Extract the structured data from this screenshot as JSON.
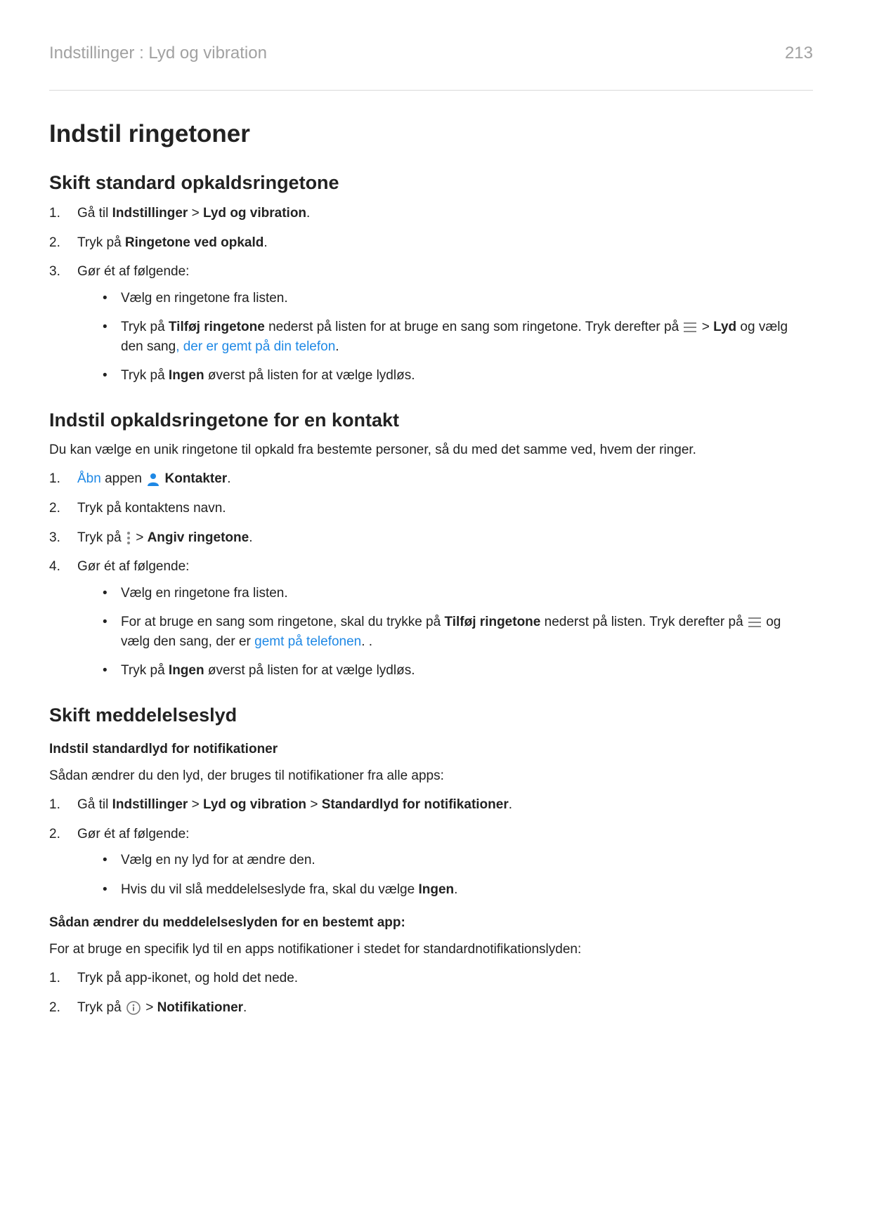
{
  "header": {
    "breadcrumb": "Indstillinger : Lyd og vibration",
    "page_number": "213"
  },
  "h1": "Indstil ringetoner",
  "sec1": {
    "h2": "Skift standard opkaldsringetone",
    "li1_a": "Gå til ",
    "li1_link": "Indstillinger",
    "li1_b": " > ",
    "li1_bold": "Lyd og vibration",
    "li1_c": ".",
    "li2_a": "Tryk på ",
    "li2_bold": "Ringetone ved opkald",
    "li2_b": ".",
    "li3": "Gør ét af følgende:",
    "li3_b1": "Vælg en ringetone fra listen.",
    "li3_b2_a": "Tryk på ",
    "li3_b2_bold1": "Tilføj ringetone",
    "li3_b2_b": " nederst på listen for at bruge en sang som ringetone. Tryk derefter på ",
    "li3_b2_c": " > ",
    "li3_b2_bold2": "Lyd",
    "li3_b2_d": " og vælg den sang",
    "li3_b2_link": ", der er gemt på din telefon",
    "li3_b2_e": ".",
    "li3_b3_a": "Tryk på ",
    "li3_b3_bold": "Ingen",
    "li3_b3_b": " øverst på listen for at vælge lydløs."
  },
  "sec2": {
    "h2": "Indstil opkaldsringetone for en kontakt",
    "intro": "Du kan vælge en unik ringetone til opkald fra bestemte personer, så du med det samme ved, hvem der ringer.",
    "li1_link": "Åbn",
    "li1_a": " appen ",
    "li1_bold": "Kontakter",
    "li1_b": ".",
    "li2": "Tryk på kontaktens navn.",
    "li3_a": "Tryk på ",
    "li3_b": " > ",
    "li3_bold": "Angiv ringetone",
    "li3_c": ".",
    "li4": "Gør ét af følgende:",
    "li4_b1": "Vælg en ringetone fra listen.",
    "li4_b2_a": "For at bruge en sang som ringetone, skal du trykke på ",
    "li4_b2_bold": "Tilføj ringetone",
    "li4_b2_b": " nederst på listen. Tryk derefter på ",
    "li4_b2_c": " og vælg den sang, der er ",
    "li4_b2_link": "gemt på telefonen",
    "li4_b2_d": ". .",
    "li4_b3_a": "Tryk på ",
    "li4_b3_bold": "Ingen",
    "li4_b3_b": " øverst på listen for at vælge lydløs."
  },
  "sec3": {
    "h2": "Skift meddelelseslyd",
    "h3a": "Indstil standardlyd for notifikationer",
    "p1": "Sådan ændrer du den lyd, der bruges til notifikationer fra alle apps:",
    "li1_a": "Gå til ",
    "li1_link": "Indstillinger",
    "li1_b": " > ",
    "li1_bold1": "Lyd og vibration",
    "li1_c": " > ",
    "li1_bold2": "Standardlyd for notifikationer",
    "li1_d": ".",
    "li2": "Gør ét af følgende:",
    "li2_b1": "Vælg en ny lyd for at ændre den.",
    "li2_b2_a": "Hvis du vil slå meddelelseslyde fra, skal du vælge ",
    "li2_b2_bold": "Ingen",
    "li2_b2_b": ".",
    "h3b": "Sådan ændrer du meddelelseslyden for en bestemt app:",
    "p2": "For at bruge en specifik lyd til en apps notifikationer i stedet for standardnotifikationslyden:",
    "li3": "Tryk på app-ikonet, og hold det nede.",
    "li4_a": "Tryk på ",
    "li4_b": " > ",
    "li4_bold": "Notifikationer",
    "li4_c": "."
  }
}
